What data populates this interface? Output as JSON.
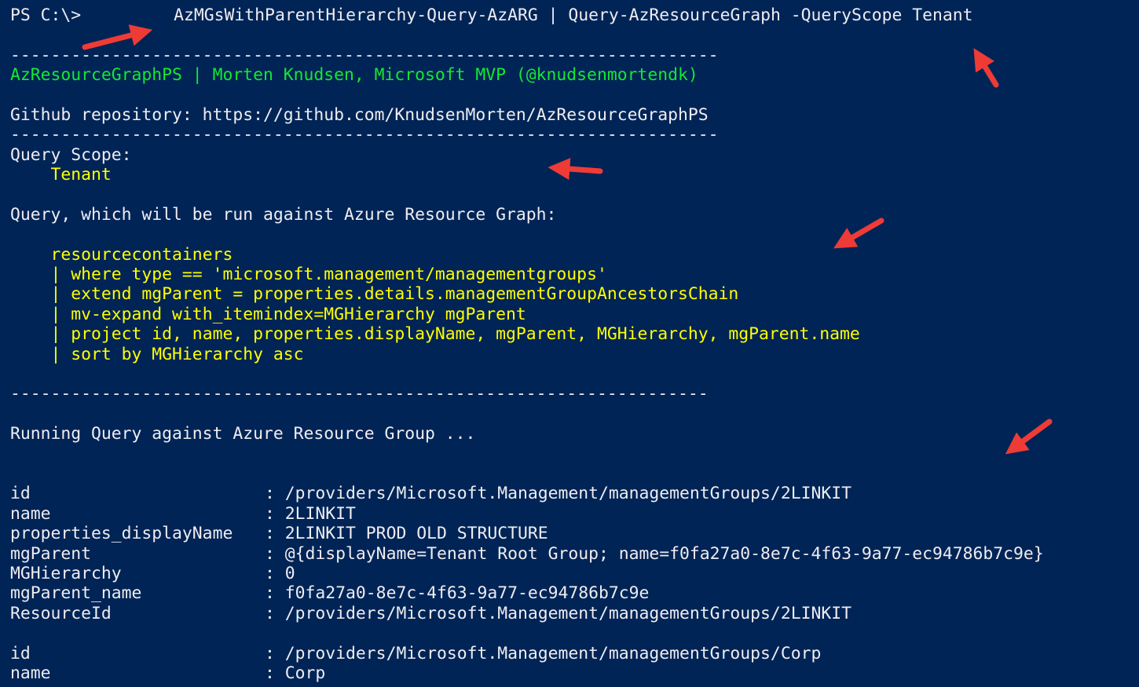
{
  "prompt": "PS C:\\>",
  "command": "AzMGsWithParentHierarchy-Query-AzARG | Query-AzResourceGraph -QueryScope Tenant",
  "separator1": "----------------------------------------------------------------------",
  "banner": "AzResourceGraphPS | Morten Knudsen, Microsoft MVP (@knudsenmortendk)",
  "github": "Github repository: https://github.com/KnudsenMorten/AzResourceGraphPS",
  "separator2": "----------------------------------------------------------------------",
  "scope_label": "Query Scope:",
  "scope_value": "Tenant",
  "query_intro": "Query, which will be run against Azure Resource Graph:",
  "query_lines": [
    "resourcecontainers",
    "| where type == 'microsoft.management/managementgroups'",
    "| extend mgParent = properties.details.managementGroupAncestorsChain",
    "| mv-expand with_itemindex=MGHierarchy mgParent",
    "| project id, name, properties.displayName, mgParent, MGHierarchy, mgParent.name",
    "| sort by MGHierarchy asc"
  ],
  "separator3": "---------------------------------------------------------------------",
  "running": "Running Query against Azure Resource Group ...",
  "records": [
    [
      {
        "key": "id",
        "value": "/providers/Microsoft.Management/managementGroups/2LINKIT"
      },
      {
        "key": "name",
        "value": "2LINKIT"
      },
      {
        "key": "properties_displayName",
        "value": "2LINKIT PROD OLD STRUCTURE"
      },
      {
        "key": "mgParent",
        "value": "@{displayName=Tenant Root Group; name=f0fa27a0-8e7c-4f63-9a77-ec94786b7c9e}"
      },
      {
        "key": "MGHierarchy",
        "value": "0"
      },
      {
        "key": "mgParent_name",
        "value": "f0fa27a0-8e7c-4f63-9a77-ec94786b7c9e"
      },
      {
        "key": "ResourceId",
        "value": "/providers/Microsoft.Management/managementGroups/2LINKIT"
      }
    ],
    [
      {
        "key": "id",
        "value": "/providers/Microsoft.Management/managementGroups/Corp"
      },
      {
        "key": "name",
        "value": "Corp"
      }
    ]
  ],
  "separator_char": ":",
  "colors": {
    "background": "#012456",
    "text": "#eeedf0",
    "highlight": "#ffff00",
    "banner": "#13e833",
    "annotation_arrow": "#ef3b36"
  },
  "icons": [
    "annotation-arrow-icon"
  ]
}
